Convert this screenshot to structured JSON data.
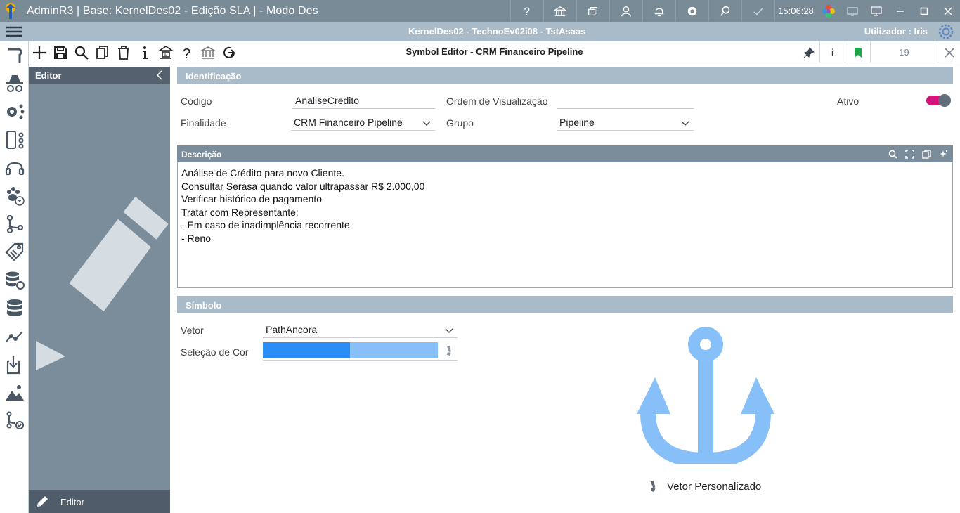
{
  "window": {
    "title": "AdminR3 | Base: KernelDes02 - Edição SLA | - Modo Des",
    "clock": "15:06:28"
  },
  "subbar": {
    "context": "KernelDes02 - TechnoEv02i08 - TstAsaas",
    "user": "Utilizador : Iris"
  },
  "toolbar": {
    "title": "Symbol Editor - CRM Financeiro Pipeline",
    "info_label": "i",
    "counter": "19"
  },
  "side": {
    "header": "Editor",
    "footer_label": "Editor"
  },
  "identificacao": {
    "header": "Identificação",
    "codigo_label": "Código",
    "codigo_value": "AnaliseCredito",
    "ordem_label": "Ordem de Visualização",
    "ordem_value": "",
    "ativo_label": "Ativo",
    "ativo_on": true,
    "finalidade_label": "Finalidade",
    "finalidade_value": "CRM Financeiro Pipeline",
    "grupo_label": "Grupo",
    "grupo_value": "Pipeline"
  },
  "descricao": {
    "header": "Descrição",
    "lines": [
      "Análise de Crédito para novo Cliente.",
      "Consultar Serasa quando valor ultrapassar R$ 2.000,00",
      "Verificar histórico de pagamento",
      "Tratar com Representante:",
      "- Em caso de inadimplência recorrente",
      "- Reno"
    ]
  },
  "simbolo": {
    "header": "Símbolo",
    "vetor_label": "Vetor",
    "vetor_value": "PathAncora",
    "cor_label": "Seleção de Cor",
    "cor_primary": "#2b8ef7",
    "cor_secondary": "#87bff8",
    "preview_label": "Vetor Personalizado"
  },
  "colors": {
    "titlebar": "#7a8b98",
    "subbar": "#a9bac8",
    "panel": "#7b8c9a",
    "toggle_on": "#d4147a",
    "anchor": "#87bff8"
  }
}
